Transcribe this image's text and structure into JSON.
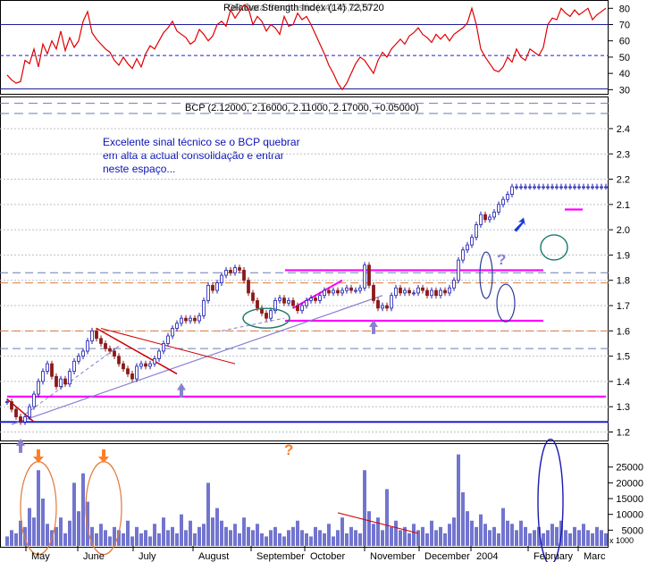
{
  "rsi_panel": {
    "legend_text": "Relative Strength Index (14) 72,5720",
    "overlapped_text": "OR Data Stochastic (14) 75,2370",
    "y_ticks": [
      "80",
      "70",
      "60",
      "50",
      "40",
      "30"
    ],
    "ylim": [
      28,
      84
    ],
    "h_lines": [
      70,
      51,
      30.5
    ]
  },
  "price_panel": {
    "legend_text": "BCP (2.12000, 2.16000, 2.11000, 2.17000, +0.05000)",
    "y_ticks": [
      "2.4",
      "2.3",
      "2.2",
      "2.1",
      "2.0",
      "1.9",
      "1.8",
      "1.7",
      "1.6",
      "1.5",
      "1.4",
      "1.3",
      "1.2"
    ],
    "ylim": [
      1.17,
      2.52
    ],
    "annotation_lines": [
      "Excelente sinal técnico se o BCP quebrar",
      "em alta a actual consolidação e entrar",
      "neste espaço..."
    ],
    "question_mark": "?",
    "colors": {
      "up": "#1a1ab0",
      "down": "#8b1a1a",
      "magenta": "#ff00ff",
      "support": "#1f1fd6",
      "trend": "#8a7fd4"
    }
  },
  "volume_panel": {
    "y_ticks": [
      "25000",
      "20000",
      "15000",
      "10000",
      "5000"
    ],
    "unit_label": "x 1000",
    "ylim": [
      0,
      32000
    ],
    "question_mark": "?"
  },
  "x_axis": {
    "months": [
      "May",
      "June",
      "July",
      "August",
      "September",
      "October",
      "November",
      "December",
      "2004",
      "February",
      "Marc"
    ]
  },
  "chart_data": [
    {
      "type": "line",
      "title": "Relative Strength Index (14)",
      "last_value": 72.572,
      "x": [
        0,
        5,
        10,
        15,
        20,
        25,
        30,
        35,
        40,
        45,
        50,
        55,
        60,
        65,
        70,
        75,
        80,
        85,
        90,
        95,
        100,
        105,
        110,
        115,
        120,
        125,
        130,
        135,
        140,
        145,
        150,
        155,
        160,
        165,
        170,
        175,
        180,
        185,
        190,
        195,
        200,
        205,
        210,
        215,
        220,
        225,
        230,
        235,
        240,
        245,
        250,
        255,
        260,
        265,
        270,
        275,
        280,
        285,
        290,
        295,
        300,
        305,
        310,
        315,
        320,
        325,
        330,
        335,
        340,
        345,
        350,
        355,
        360,
        365,
        370,
        375,
        380,
        385,
        390,
        395,
        400,
        405,
        410,
        415,
        420,
        425,
        430,
        435,
        440,
        445,
        450,
        455,
        460,
        465,
        470,
        475,
        480,
        485,
        490,
        495,
        500,
        505,
        510,
        515,
        520,
        525,
        530,
        535,
        540,
        545,
        550,
        555,
        560,
        565,
        570,
        575,
        580,
        585,
        590,
        595,
        600,
        605,
        610,
        615,
        620,
        625,
        630,
        635,
        640,
        645,
        650,
        655,
        660,
        665,
        670
      ],
      "y": [
        39,
        36,
        34,
        35,
        48,
        46,
        55,
        44,
        58,
        52,
        60,
        55,
        66,
        54,
        62,
        56,
        60,
        72,
        78,
        65,
        61,
        58,
        55,
        53,
        48,
        45,
        50,
        46,
        43,
        49,
        44,
        52,
        57,
        55,
        60,
        65,
        68,
        72,
        66,
        64,
        62,
        58,
        60,
        67,
        64,
        60,
        63,
        70,
        72,
        69,
        79,
        74,
        78,
        82,
        80,
        70,
        75,
        72,
        66,
        70,
        68,
        64,
        75,
        69,
        70,
        77,
        73,
        75,
        70,
        64,
        58,
        52,
        45,
        40,
        34,
        30,
        34,
        40,
        46,
        50,
        48,
        44,
        40,
        48,
        53,
        50,
        55,
        58,
        61,
        58,
        63,
        65,
        68,
        64,
        62,
        59,
        64,
        61,
        64,
        60,
        64,
        66,
        68,
        71,
        80,
        70,
        55,
        50,
        46,
        42,
        41,
        44,
        50,
        47,
        55,
        50,
        48,
        55,
        53,
        51,
        56,
        70,
        74,
        73,
        80,
        77,
        75,
        79,
        76,
        78,
        80,
        73,
        76,
        78,
        80
      ],
      "ylim": [
        28,
        84
      ]
    },
    {
      "type": "candlestick",
      "title": "BCP",
      "last": {
        "open": 2.12,
        "high": 2.16,
        "low": 2.11,
        "close": 2.17,
        "change": 0.05
      },
      "x": [
        0,
        5,
        10,
        15,
        20,
        25,
        30,
        35,
        40,
        45,
        50,
        55,
        60,
        65,
        70,
        75,
        80,
        85,
        90,
        95,
        100,
        105,
        110,
        115,
        120,
        125,
        130,
        135,
        140,
        145,
        150,
        155,
        160,
        165,
        170,
        175,
        180,
        185,
        190,
        195,
        200,
        205,
        210,
        215,
        220,
        225,
        230,
        235,
        240,
        245,
        250,
        255,
        260,
        265,
        270,
        275,
        280,
        285,
        290,
        295,
        300,
        305,
        310,
        315,
        320,
        325,
        330,
        335,
        340,
        345,
        350,
        355,
        360,
        365,
        370,
        375,
        380,
        385,
        390,
        395,
        400,
        405,
        410,
        415,
        420,
        425,
        430,
        435,
        440,
        445,
        450,
        455,
        460,
        465,
        470,
        475,
        480,
        485,
        490,
        495,
        500,
        505,
        510,
        515,
        520,
        525,
        530,
        535,
        540,
        545,
        550,
        555,
        560,
        565,
        570,
        575,
        580,
        585,
        590,
        595,
        600,
        605,
        610,
        615,
        620,
        625,
        630,
        635,
        640,
        645,
        650,
        655,
        660,
        665,
        670
      ],
      "close": [
        1.32,
        1.29,
        1.26,
        1.24,
        1.26,
        1.3,
        1.35,
        1.4,
        1.44,
        1.47,
        1.42,
        1.38,
        1.41,
        1.39,
        1.44,
        1.48,
        1.5,
        1.52,
        1.56,
        1.6,
        1.57,
        1.55,
        1.53,
        1.52,
        1.5,
        1.47,
        1.45,
        1.43,
        1.41,
        1.46,
        1.47,
        1.46,
        1.47,
        1.49,
        1.52,
        1.55,
        1.58,
        1.61,
        1.63,
        1.65,
        1.64,
        1.65,
        1.64,
        1.66,
        1.72,
        1.78,
        1.76,
        1.79,
        1.82,
        1.84,
        1.83,
        1.85,
        1.84,
        1.8,
        1.75,
        1.72,
        1.69,
        1.67,
        1.65,
        1.68,
        1.72,
        1.73,
        1.71,
        1.72,
        1.7,
        1.68,
        1.7,
        1.72,
        1.73,
        1.72,
        1.74,
        1.76,
        1.75,
        1.76,
        1.75,
        1.76,
        1.77,
        1.76,
        1.76,
        1.77,
        1.86,
        1.78,
        1.72,
        1.69,
        1.7,
        1.69,
        1.74,
        1.77,
        1.75,
        1.76,
        1.75,
        1.75,
        1.77,
        1.76,
        1.74,
        1.76,
        1.74,
        1.76,
        1.75,
        1.77,
        1.8,
        1.88,
        1.92,
        1.94,
        1.97,
        2.02,
        2.06,
        2.04,
        2.05,
        2.07,
        2.1,
        2.12,
        2.14,
        2.17,
        2.17,
        2.17,
        2.17,
        2.17,
        2.17,
        2.17,
        2.17,
        2.17,
        2.17,
        2.17,
        2.17,
        2.17,
        2.17,
        2.17,
        2.17,
        2.17,
        2.17,
        2.17,
        2.17,
        2.17,
        2.17
      ],
      "ylim": [
        1.17,
        2.52
      ],
      "h_lines": {
        "magenta": [
          1.84,
          1.64,
          1.34
        ],
        "support": [
          1.24
        ],
        "dashed_red": [
          1.6,
          1.79
        ],
        "dashed_blue": [
          1.83,
          1.53
        ]
      }
    },
    {
      "type": "bar",
      "title": "Volume",
      "x": [
        0,
        5,
        10,
        15,
        20,
        25,
        30,
        35,
        40,
        45,
        50,
        55,
        60,
        65,
        70,
        75,
        80,
        85,
        90,
        95,
        100,
        105,
        110,
        115,
        120,
        125,
        130,
        135,
        140,
        145,
        150,
        155,
        160,
        165,
        170,
        175,
        180,
        185,
        190,
        195,
        200,
        205,
        210,
        215,
        220,
        225,
        230,
        235,
        240,
        245,
        250,
        255,
        260,
        265,
        270,
        275,
        280,
        285,
        290,
        295,
        300,
        305,
        310,
        315,
        320,
        325,
        330,
        335,
        340,
        345,
        350,
        355,
        360,
        365,
        370,
        375,
        380,
        385,
        390,
        395,
        400,
        405,
        410,
        415,
        420,
        425,
        430,
        435,
        440,
        445,
        450,
        455,
        460,
        465,
        470,
        475,
        480,
        485,
        490,
        495,
        500,
        505,
        510,
        515,
        520,
        525,
        530,
        535,
        540,
        545,
        550,
        555,
        560,
        565,
        570,
        575,
        580,
        585,
        590,
        595,
        600,
        605,
        610,
        615,
        620,
        625,
        630,
        635,
        640,
        645,
        650,
        655,
        660,
        665,
        670
      ],
      "values": [
        3000,
        5000,
        4000,
        8000,
        6000,
        12000,
        9000,
        24000,
        15000,
        7000,
        5000,
        6000,
        9000,
        4000,
        8000,
        20000,
        11000,
        23000,
        14000,
        6000,
        4000,
        7000,
        5000,
        3000,
        6000,
        5000,
        4000,
        8000,
        3000,
        6000,
        4000,
        5000,
        3000,
        7000,
        4000,
        9000,
        5000,
        6000,
        4000,
        10000,
        5000,
        8000,
        4000,
        6000,
        7000,
        20000,
        9000,
        12000,
        8000,
        6000,
        5000,
        7000,
        4000,
        9000,
        6000,
        5000,
        7000,
        4000,
        3000,
        5000,
        6000,
        4000,
        3000,
        5000,
        6000,
        8000,
        5000,
        4000,
        3000,
        6000,
        5000,
        4000,
        7000,
        3000,
        5000,
        9000,
        4000,
        6000,
        5000,
        4000,
        24000,
        11000,
        7000,
        9000,
        5000,
        18000,
        6000,
        8000,
        5000,
        6000,
        4000,
        7000,
        5000,
        6000,
        4000,
        8000,
        5000,
        6000,
        4000,
        7000,
        9000,
        29000,
        17000,
        11000,
        8000,
        6000,
        10000,
        7000,
        5000,
        6000,
        4000,
        12000,
        8000,
        7000,
        5000,
        8000,
        6000,
        4000,
        5000,
        6000,
        4000,
        5000,
        7000,
        6000,
        8000,
        5000,
        4000,
        6000,
        5000,
        7000,
        5000,
        4000,
        6000,
        5000,
        4000
      ],
      "ylim": [
        0,
        32000
      ]
    }
  ]
}
